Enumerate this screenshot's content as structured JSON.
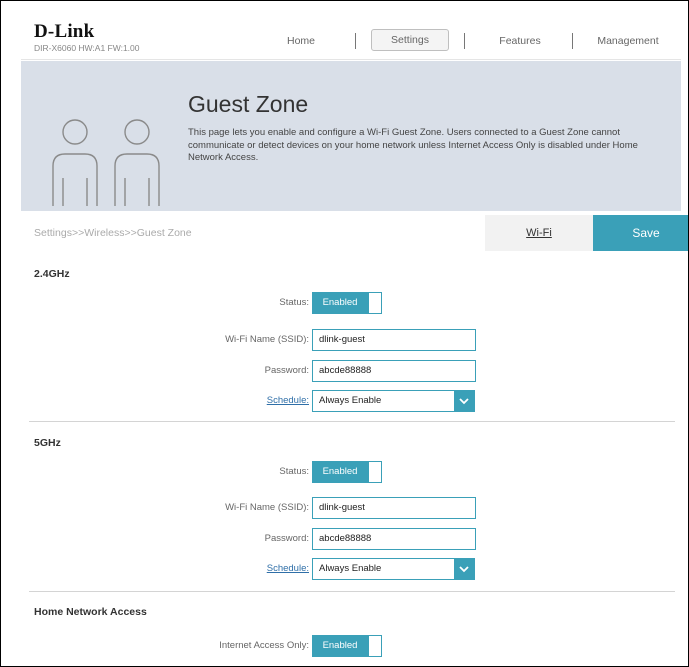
{
  "brand": {
    "logo": "D-Link",
    "model_info": "DIR-X6060 HW:A1 FW:1.00"
  },
  "nav": {
    "home": "Home",
    "settings": "Settings",
    "features": "Features",
    "management": "Management"
  },
  "banner": {
    "title": "Guest Zone",
    "description": "This page lets you enable and configure a Wi-Fi Guest Zone. Users connected to a Guest Zone cannot communicate or detect devices on your home network unless Internet Access Only is disabled under Home Network Access."
  },
  "breadcrumb": "Settings>>Wireless>>Guest Zone",
  "actions": {
    "wifi_link": "Wi-Fi",
    "save": "Save"
  },
  "band_24": {
    "title": "2.4GHz",
    "status_label": "Status:",
    "status_value": "Enabled",
    "ssid_label": "Wi-Fi Name (SSID):",
    "ssid_value": "dlink-guest",
    "password_label": "Password:",
    "password_value": "abcde88888",
    "schedule_label": "Schedule:",
    "schedule_value": "Always Enable"
  },
  "band_5": {
    "title": "5GHz",
    "status_label": "Status:",
    "status_value": "Enabled",
    "ssid_label": "Wi-Fi Name (SSID):",
    "ssid_value": "dlink-guest",
    "password_label": "Password:",
    "password_value": "abcde88888",
    "schedule_label": "Schedule:",
    "schedule_value": "Always Enable"
  },
  "home_network": {
    "title": "Home Network Access",
    "internet_only_label": "Internet Access Only:",
    "internet_only_value": "Enabled"
  },
  "colors": {
    "accent": "#3aa0b8",
    "banner_bg": "#d9dfe8",
    "link": "#2f6fa8"
  },
  "icons": {
    "users": "guest-users-icon",
    "dropdown": "chevron-down-icon"
  }
}
